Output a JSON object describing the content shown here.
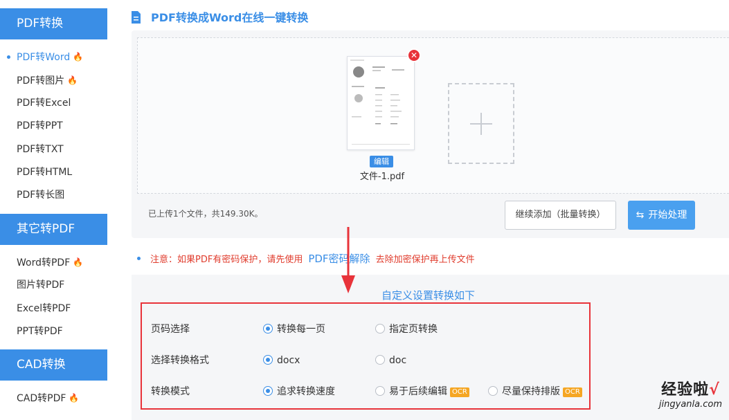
{
  "sidebar": {
    "sections": [
      {
        "header": "PDF转换",
        "items": [
          {
            "label": "PDF转Word",
            "hot": true,
            "active": true
          },
          {
            "label": "PDF转图片",
            "hot": true
          },
          {
            "label": "PDF转Excel"
          },
          {
            "label": "PDF转PPT"
          },
          {
            "label": "PDF转TXT"
          },
          {
            "label": "PDF转HTML"
          },
          {
            "label": "PDF转长图"
          }
        ]
      },
      {
        "header": "其它转PDF",
        "items": [
          {
            "label": "Word转PDF",
            "hot": true
          },
          {
            "label": "图片转PDF"
          },
          {
            "label": "Excel转PDF"
          },
          {
            "label": "PPT转PDF"
          }
        ]
      },
      {
        "header": "CAD转换",
        "items": [
          {
            "label": "CAD转PDF",
            "hot": true
          }
        ]
      }
    ],
    "hot_icon": "fire-icon"
  },
  "main": {
    "title": "PDF转换成Word在线一键转换",
    "upload": {
      "file_name": "文件-1.pdf",
      "edit_label": "编辑",
      "status": "已上传1个文件，共149.30K。",
      "continue_label": "继续添加（批量转换）",
      "start_label": "开始处理"
    },
    "notice": {
      "prefix": "注意：如果PDF有密码保护，请先使用",
      "link": "PDF密码解除",
      "suffix": "去除加密保护再上传文件"
    },
    "settings": {
      "title": "自定义设置转换如下",
      "rows": [
        {
          "label": "页码选择",
          "options": [
            {
              "label": "转换每一页",
              "selected": true
            },
            {
              "label": "指定页转换",
              "selected": false
            }
          ]
        },
        {
          "label": "选择转换格式",
          "options": [
            {
              "label": "docx",
              "selected": true
            },
            {
              "label": "doc",
              "selected": false
            }
          ]
        },
        {
          "label": "转换模式",
          "options": [
            {
              "label": "追求转换速度",
              "selected": true
            },
            {
              "label": "易于后续编辑",
              "selected": false,
              "badge": "OCR"
            },
            {
              "label": "尽量保持排版",
              "selected": false,
              "badge": "OCR"
            }
          ]
        }
      ]
    }
  },
  "watermark": {
    "line1": "经验啦",
    "check": "√",
    "line2": "jingyanla.com"
  },
  "colors": {
    "accent": "#3a8ee6",
    "danger": "#e8333a",
    "ocr_badge": "#f5a623",
    "hot": "#f57c2a"
  }
}
